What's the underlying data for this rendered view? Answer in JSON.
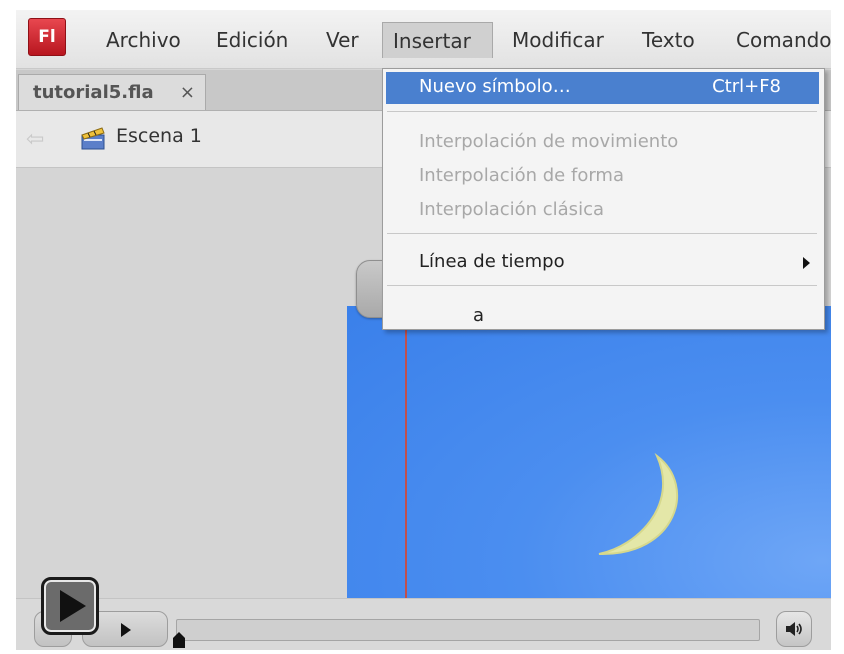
{
  "app": {
    "logo": "Fl"
  },
  "menubar": {
    "items": [
      "Archivo",
      "Edición",
      "Ver",
      "Insertar",
      "Modificar",
      "Texto",
      "Comando"
    ]
  },
  "tab": {
    "filename": "tutorial5.fla",
    "close_glyph": "×"
  },
  "scene": {
    "label": "Escena 1",
    "back_glyph": "⇦",
    "clapper_icon": "clapperboard-icon"
  },
  "dropdown": {
    "highlighted": {
      "label": "Nuevo símbolo…",
      "shortcut": "Ctrl+F8"
    },
    "disabled_items": [
      "Interpolación de movimiento",
      "Interpolación de forma",
      "Interpolación clásica"
    ],
    "timeline_item": "Línea de tiempo",
    "partial_item": "a"
  },
  "colors": {
    "stage": "#3a80ea",
    "highlight": "#4a80cf",
    "logo": "#c61f28"
  }
}
